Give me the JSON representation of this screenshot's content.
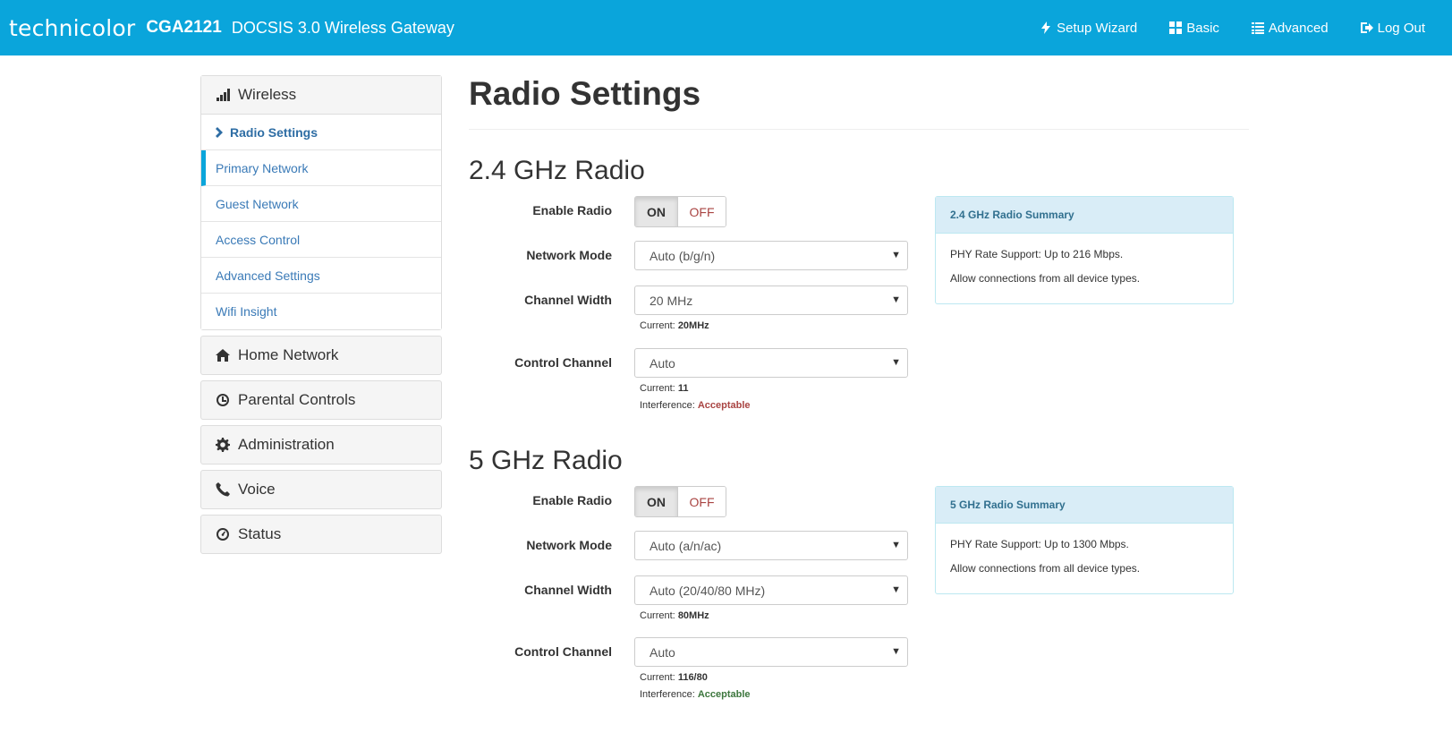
{
  "header": {
    "logo": "technicolor",
    "model": "CGA2121",
    "description": "DOCSIS 3.0 Wireless Gateway",
    "nav": {
      "setup_wizard": "Setup Wizard",
      "basic": "Basic",
      "advanced": "Advanced",
      "logout": "Log Out"
    }
  },
  "sidebar": {
    "wireless": "Wireless",
    "wireless_items": {
      "radio_settings": "Radio Settings",
      "primary_network": "Primary Network",
      "guest_network": "Guest Network",
      "access_control": "Access Control",
      "advanced_settings": "Advanced Settings",
      "wifi_insight": "Wifi Insight"
    },
    "home_network": "Home Network",
    "parental_controls": "Parental Controls",
    "administration": "Administration",
    "voice": "Voice",
    "status": "Status"
  },
  "main": {
    "title": "Radio Settings",
    "radio24": {
      "title": "2.4 GHz Radio",
      "enable_label": "Enable Radio",
      "on": "ON",
      "off": "OFF",
      "mode_label": "Network Mode",
      "mode_value": "Auto (b/g/n)",
      "width_label": "Channel Width",
      "width_value": "20 MHz",
      "width_current_label": "Current:",
      "width_current": "20MHz",
      "channel_label": "Control Channel",
      "channel_value": "Auto",
      "channel_current_label": "Current:",
      "channel_current": "11",
      "interference_label": "Interference:",
      "interference": "Acceptable",
      "summary_title": "2.4 GHz Radio Summary",
      "summary_line1": "PHY Rate Support: Up to 216 Mbps.",
      "summary_line2": "Allow connections from all device types."
    },
    "radio5": {
      "title": "5 GHz Radio",
      "enable_label": "Enable Radio",
      "on": "ON",
      "off": "OFF",
      "mode_label": "Network Mode",
      "mode_value": "Auto (a/n/ac)",
      "width_label": "Channel Width",
      "width_value": "Auto (20/40/80 MHz)",
      "width_current_label": "Current:",
      "width_current": "80MHz",
      "channel_label": "Control Channel",
      "channel_value": "Auto",
      "channel_current_label": "Current:",
      "channel_current": "116/80",
      "interference_label": "Interference:",
      "interference": "Acceptable",
      "summary_title": "5 GHz Radio Summary",
      "summary_line1": "PHY Rate Support: Up to 1300 Mbps.",
      "summary_line2": "Allow connections from all device types."
    }
  },
  "colors": {
    "header_bg": "#0aa5db",
    "link": "#3a7ab7",
    "interference_24": "#a94442",
    "interference_5": "#3c763d"
  }
}
